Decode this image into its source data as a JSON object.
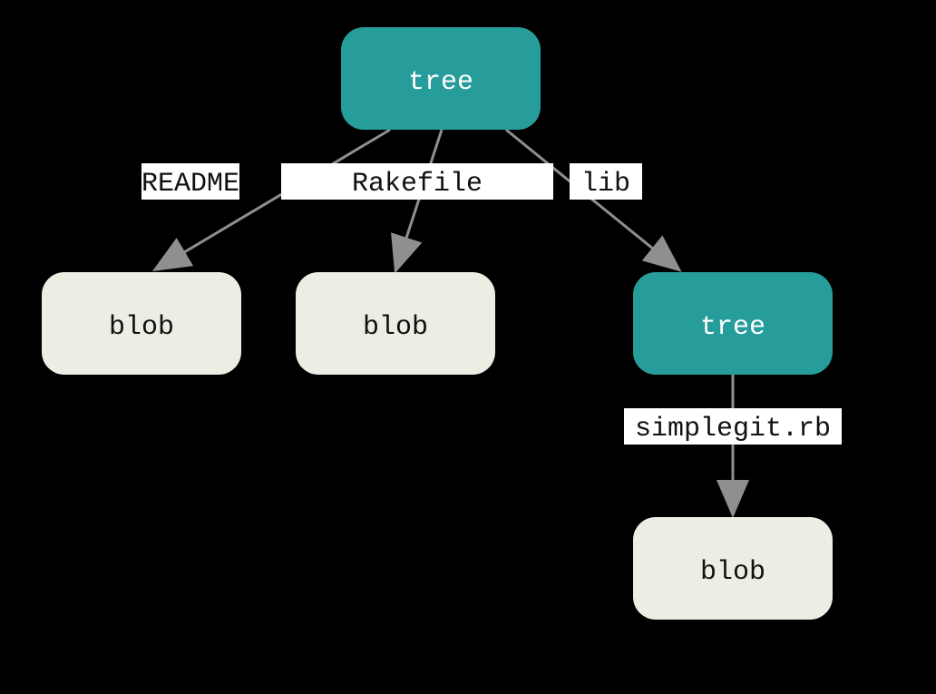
{
  "nodes": {
    "root": "tree",
    "blob1": "blob",
    "blob2": "blob",
    "subtree": "tree",
    "blob3": "blob"
  },
  "edges": {
    "readme": "README",
    "rakefile": "Rakefile",
    "lib": "lib",
    "simplegit": "simplegit.rb"
  }
}
